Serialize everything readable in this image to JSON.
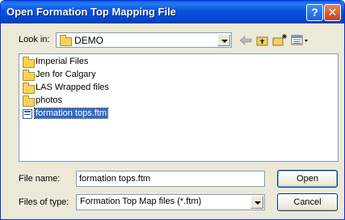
{
  "window": {
    "title": "Open Formation Top Mapping File",
    "help_glyph": "?",
    "close_glyph": "✕"
  },
  "look_in": {
    "label": "Look in:",
    "value": "DEMO"
  },
  "toolbar": {
    "back_icon": "back-arrow-icon",
    "up_icon": "up-folder-icon",
    "new_folder_icon": "new-folder-icon",
    "views_icon": "views-menu-icon"
  },
  "files": [
    {
      "name": "Imperial Files",
      "type": "folder"
    },
    {
      "name": "Jen for Calgary",
      "type": "folder"
    },
    {
      "name": "LAS Wrapped files",
      "type": "folder"
    },
    {
      "name": "photos",
      "type": "folder"
    },
    {
      "name": "formation tops.ftm",
      "type": "file",
      "selected": true
    }
  ],
  "file_name": {
    "label": "File name:",
    "value": "formation tops.ftm"
  },
  "file_type": {
    "label": "Files of type:",
    "value": "Formation Top Map files (*.ftm)"
  },
  "buttons": {
    "open": "Open",
    "cancel": "Cancel"
  }
}
